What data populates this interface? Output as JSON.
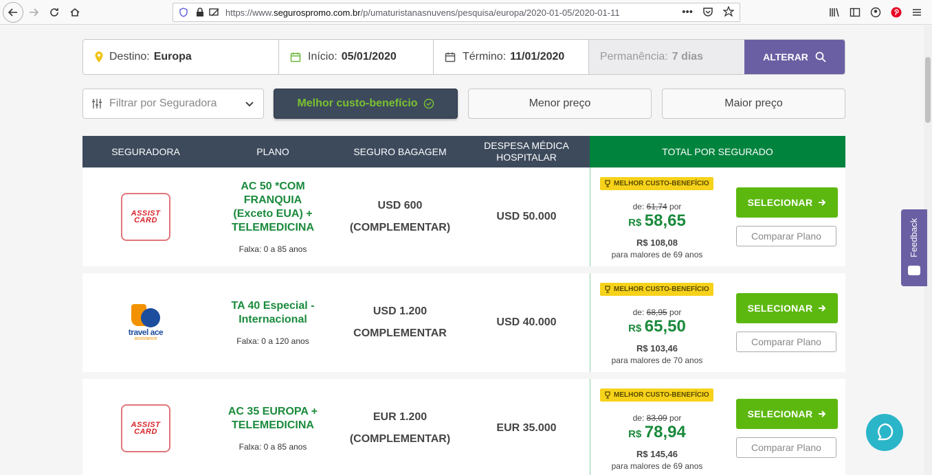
{
  "browser": {
    "url_prefix": "https://www.",
    "url_domain": "segurospromo.com.br",
    "url_path": "/p/umaturistanasnuvens/pesquisa/europa/2020-01-05/2020-01-11"
  },
  "search": {
    "destino_label": "Destino:",
    "destino_value": "Europa",
    "inicio_label": "Início:",
    "inicio_value": "05/01/2020",
    "termino_label": "Término:",
    "termino_value": "11/01/2020",
    "permanencia_label": "Permanência:",
    "permanencia_value": "7 dias",
    "alterar_label": "ALTERAR"
  },
  "filters": {
    "seguradora_placeholder": "Filtrar por Seguradora",
    "best": "Melhor custo-benefício",
    "lowest": "Menor preço",
    "highest": "Maior preço"
  },
  "table_header": {
    "seguradora": "SEGURADORA",
    "plano": "PLANO",
    "bagagem": "SEGURO BAGAGEM",
    "despesa_line1": "DESPESA MÉDICA",
    "despesa_line2": "HOSPITALAR",
    "total": "TOTAL POR SEGURADO"
  },
  "rows": [
    {
      "logo": "assist-card",
      "logo_line1": "ASSIST",
      "logo_line2": "CARD",
      "plan_line1": "AC 50 *COM FRANQUIA",
      "plan_line2": "(Exceto EUA) +",
      "plan_line3": "TELEMEDICINA",
      "range": "Falxa: 0 a 85 anos",
      "bag_line1": "USD 600",
      "bag_line2": "(COMPLEMENTAR)",
      "medical": "USD 50.000",
      "badge": "MELHOR CUSTO-BENEFÍCIO",
      "de_label": "de:",
      "old_price": "61,74",
      "por_label": "por",
      "currency": "R$",
      "price": "58,65",
      "senior_price": "R$ 108,08",
      "senior_note": "para malores de 69 anos",
      "select_label": "SELECIONAR",
      "compare_label": "Comparar Plano"
    },
    {
      "logo": "travel-ace",
      "logo_line1": "travel ace",
      "logo_line2": "assistance",
      "plan_line1": "TA 40 Especial -",
      "plan_line2": "Internacional",
      "plan_line3": "",
      "range": "Falxa: 0 a 120 anos",
      "bag_line1": "USD 1.200",
      "bag_line2": "COMPLEMENTAR",
      "medical": "USD 40.000",
      "badge": "MELHOR CUSTO-BENEFÍCIO",
      "de_label": "de:",
      "old_price": "68,95",
      "por_label": "por",
      "currency": "R$",
      "price": "65,50",
      "senior_price": "R$ 103,46",
      "senior_note": "para malores de 70 anos",
      "select_label": "SELECIONAR",
      "compare_label": "Comparar Plano"
    },
    {
      "logo": "assist-card",
      "logo_line1": "ASSIST",
      "logo_line2": "CARD",
      "plan_line1": "AC 35 EUROPA +",
      "plan_line2": "TELEMEDICINA",
      "plan_line3": "",
      "range": "Falxa: 0 a 85 anos",
      "bag_line1": "EUR 1.200",
      "bag_line2": "(COMPLEMENTAR)",
      "medical": "EUR 35.000",
      "badge": "MELHOR CUSTO-BENEFÍCIO",
      "de_label": "de:",
      "old_price": "83,09",
      "por_label": "por",
      "currency": "R$",
      "price": "78,94",
      "senior_price": "R$ 145,46",
      "senior_note": "para malores de 69 anos",
      "select_label": "SELECIONAR",
      "compare_label": "Comparar Plano"
    }
  ],
  "feedback_label": "Feedback",
  "colors": {
    "accent_purple": "#6b5fa3",
    "header_dark": "#3d4a5c",
    "total_green": "#00833d",
    "button_green": "#5cb80f",
    "badge_yellow": "#f6d21a"
  }
}
